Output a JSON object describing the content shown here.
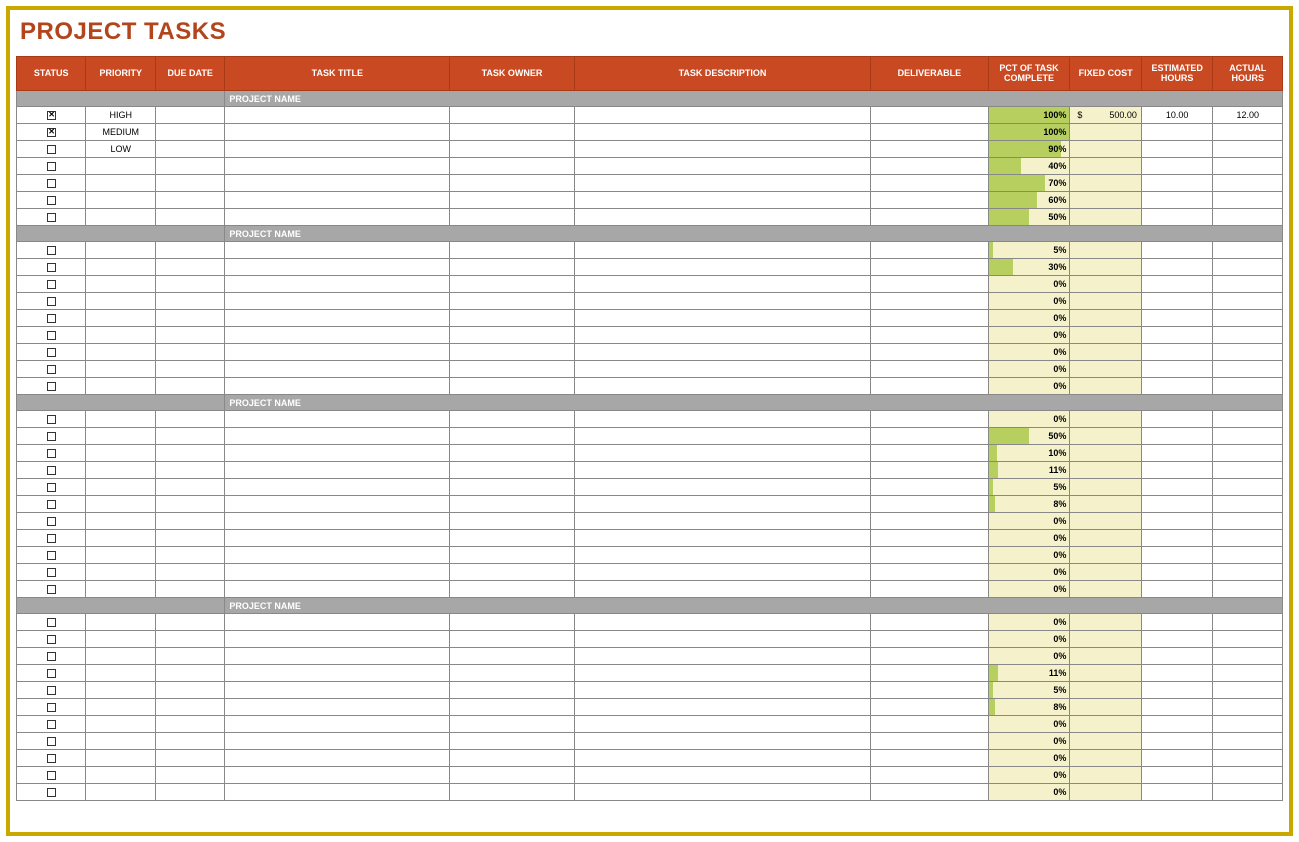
{
  "title": "PROJECT TASKS",
  "section_label": "PROJECT NAME",
  "columns": {
    "status": "STATUS",
    "priority": "PRIORITY",
    "due_date": "DUE DATE",
    "task_title": "TASK TITLE",
    "task_owner": "TASK OWNER",
    "task_description": "TASK DESCRIPTION",
    "deliverable": "DELIVERABLE",
    "pct": "PCT OF TASK COMPLETE",
    "fixed_cost": "FIXED COST",
    "est_hours": "ESTIMATED HOURS",
    "act_hours": "ACTUAL HOURS"
  },
  "sections": [
    {
      "rows": [
        {
          "checked": true,
          "priority": "HIGH",
          "pct": 100,
          "cost": "500.00",
          "est": "10.00",
          "act": "12.00"
        },
        {
          "checked": true,
          "priority": "MEDIUM",
          "pct": 100
        },
        {
          "checked": false,
          "priority": "LOW",
          "pct": 90
        },
        {
          "checked": false,
          "pct": 40
        },
        {
          "checked": false,
          "pct": 70
        },
        {
          "checked": false,
          "pct": 60
        },
        {
          "checked": false,
          "pct": 50
        }
      ]
    },
    {
      "rows": [
        {
          "checked": false,
          "pct": 5
        },
        {
          "checked": false,
          "pct": 30
        },
        {
          "checked": false,
          "pct": 0
        },
        {
          "checked": false,
          "pct": 0
        },
        {
          "checked": false,
          "pct": 0
        },
        {
          "checked": false,
          "pct": 0
        },
        {
          "checked": false,
          "pct": 0
        },
        {
          "checked": false,
          "pct": 0
        },
        {
          "checked": false,
          "pct": 0
        }
      ]
    },
    {
      "rows": [
        {
          "checked": false,
          "pct": 0
        },
        {
          "checked": false,
          "pct": 50
        },
        {
          "checked": false,
          "pct": 10
        },
        {
          "checked": false,
          "pct": 11
        },
        {
          "checked": false,
          "pct": 5
        },
        {
          "checked": false,
          "pct": 8
        },
        {
          "checked": false,
          "pct": 0
        },
        {
          "checked": false,
          "pct": 0
        },
        {
          "checked": false,
          "pct": 0
        },
        {
          "checked": false,
          "pct": 0
        },
        {
          "checked": false,
          "pct": 0
        }
      ]
    },
    {
      "rows": [
        {
          "checked": false,
          "pct": 0
        },
        {
          "checked": false,
          "pct": 0
        },
        {
          "checked": false,
          "pct": 0
        },
        {
          "checked": false,
          "pct": 11
        },
        {
          "checked": false,
          "pct": 5
        },
        {
          "checked": false,
          "pct": 8
        },
        {
          "checked": false,
          "pct": 0
        },
        {
          "checked": false,
          "pct": 0
        },
        {
          "checked": false,
          "pct": 0
        },
        {
          "checked": false,
          "pct": 0
        },
        {
          "checked": false,
          "pct": 0
        }
      ]
    }
  ]
}
